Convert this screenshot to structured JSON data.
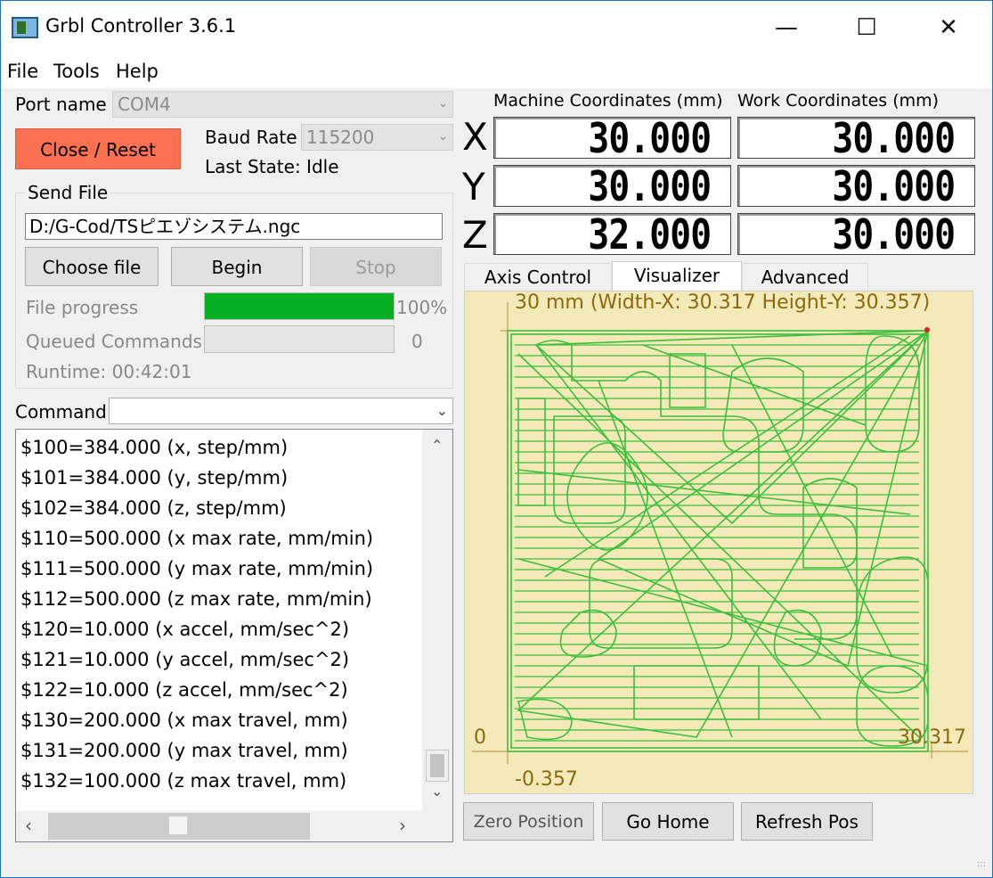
{
  "window": {
    "title": "Grbl Controller 3.6.1",
    "icons": [
      "app-icon",
      "minimize-icon",
      "maximize-icon",
      "close-icon"
    ]
  },
  "menu": [
    "File",
    "Tools",
    "Help"
  ],
  "port": {
    "label": "Port name",
    "value": "COM4"
  },
  "close_reset": "Close / Reset",
  "baud": {
    "label": "Baud Rate",
    "value": "115200"
  },
  "last_state": "Last State: Idle",
  "send_file": {
    "title": "Send File",
    "path": "D:/G-Cod/TSピエゾシステム.ngc",
    "choose": "Choose file",
    "begin": "Begin",
    "stop": "Stop",
    "progress_label": "File progress",
    "progress_value": 1.0,
    "progress_text": "100%",
    "queued_label": "Queued Commands",
    "queued_value": "0",
    "runtime": "Runtime:  00:42:01"
  },
  "command": {
    "label": "Command",
    "value": ""
  },
  "console_lines": [
    "$100=384.000 (x, step/mm)",
    "$101=384.000 (y, step/mm)",
    "$102=384.000 (z, step/mm)",
    "$110=500.000 (x max rate, mm/min)",
    "$111=500.000 (y max rate, mm/min)",
    "$112=500.000 (z max rate, mm/min)",
    "$120=10.000 (x accel, mm/sec^2)",
    "$121=10.000 (y accel, mm/sec^2)",
    "$122=10.000 (z accel, mm/sec^2)",
    "$130=200.000 (x max travel, mm)",
    "$131=200.000 (y max travel, mm)",
    "$132=100.000 (z max travel, mm)"
  ],
  "coords": {
    "machine_header": "Machine Coordinates (mm)",
    "work_header": "Work Coordinates (mm)",
    "axes": [
      {
        "axis": "X",
        "machine": "30.000",
        "work": "30.000"
      },
      {
        "axis": "Y",
        "machine": "30.000",
        "work": "30.000"
      },
      {
        "axis": "Z",
        "machine": "32.000",
        "work": "30.000"
      }
    ]
  },
  "tabs": [
    "Axis Control",
    "Visualizer",
    "Advanced"
  ],
  "active_tab": "Visualizer",
  "visualizer": {
    "header": "30 mm  (Width-X: 30.317  Height-Y: 30.357)",
    "origin_label": "0",
    "x_max_label": "30.317",
    "y_min_label": "-0.357",
    "toolpath_color": "#3dbf3d",
    "background": "#f3e9b9"
  },
  "bottom_buttons": {
    "zero": "Zero Position",
    "home": "Go Home",
    "refresh": "Refresh Pos"
  }
}
